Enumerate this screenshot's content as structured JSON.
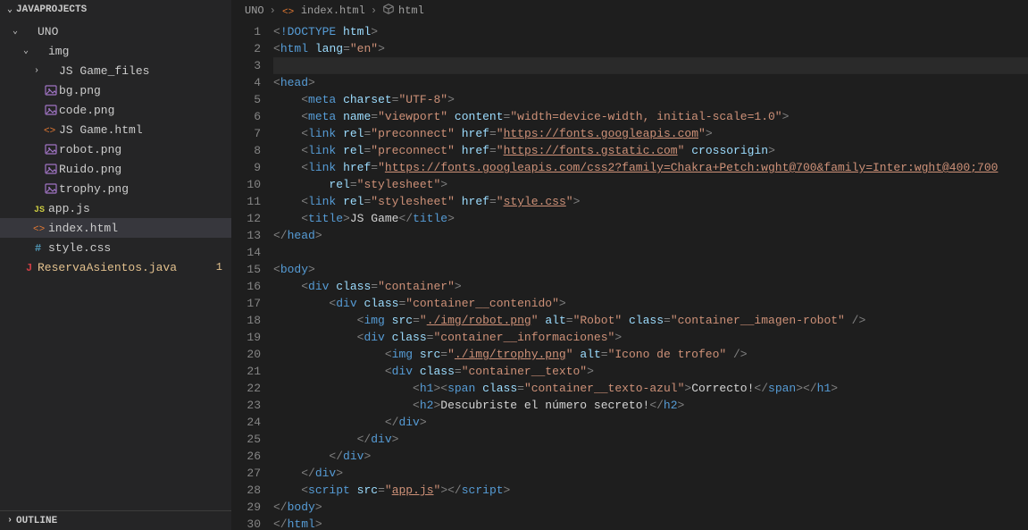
{
  "sidebar": {
    "projectHeader": "JAVAPROJECTS",
    "outline": "OUTLINE",
    "tree": [
      {
        "id": "uno",
        "depth": 0,
        "expand": "open",
        "icon": "",
        "label": "UNO",
        "labelMod": false
      },
      {
        "id": "img",
        "depth": 1,
        "expand": "open",
        "icon": "",
        "label": "img",
        "labelMod": false
      },
      {
        "id": "jsgamefiles",
        "depth": 2,
        "expand": "closed",
        "icon": "",
        "label": "JS Game_files",
        "labelMod": false
      },
      {
        "id": "bg",
        "depth": 2,
        "expand": "none",
        "icon": "image",
        "label": "bg.png",
        "labelMod": false
      },
      {
        "id": "code",
        "depth": 2,
        "expand": "none",
        "icon": "image",
        "label": "code.png",
        "labelMod": false
      },
      {
        "id": "jsgamehtml",
        "depth": 2,
        "expand": "none",
        "icon": "html",
        "label": "JS Game.html",
        "labelMod": false
      },
      {
        "id": "robot",
        "depth": 2,
        "expand": "none",
        "icon": "image",
        "label": "robot.png",
        "labelMod": false
      },
      {
        "id": "ruido",
        "depth": 2,
        "expand": "none",
        "icon": "image",
        "label": "Ruido.png",
        "labelMod": false
      },
      {
        "id": "trophy",
        "depth": 2,
        "expand": "none",
        "icon": "image",
        "label": "trophy.png",
        "labelMod": false
      },
      {
        "id": "appjs",
        "depth": 1,
        "expand": "none",
        "icon": "js",
        "label": "app.js",
        "labelMod": false
      },
      {
        "id": "indexhtml",
        "depth": 1,
        "expand": "none",
        "icon": "html",
        "label": "index.html",
        "labelMod": false,
        "active": true
      },
      {
        "id": "stylecss",
        "depth": 1,
        "expand": "none",
        "icon": "css",
        "label": "style.css",
        "labelMod": false
      },
      {
        "id": "reserva",
        "depth": 0,
        "expand": "none",
        "icon": "java",
        "label": "ReservaAsientos.java",
        "labelMod": true,
        "badge": "1"
      }
    ]
  },
  "breadcrumb": {
    "parts": [
      "UNO",
      "index.html",
      "html"
    ],
    "icon1": "html",
    "icon2": "cube"
  },
  "editor": {
    "lineCount": 30,
    "currentLine": 3,
    "lines": [
      [
        [
          "pun",
          "<"
        ],
        [
          "doctype",
          "!DOCTYPE"
        ],
        [
          "text",
          " "
        ],
        [
          "attr",
          "html"
        ],
        [
          "pun",
          ">"
        ]
      ],
      [
        [
          "pun",
          "<"
        ],
        [
          "tag",
          "html"
        ],
        [
          "text",
          " "
        ],
        [
          "attr",
          "lang"
        ],
        [
          "pun",
          "="
        ],
        [
          "str",
          "\"en\""
        ],
        [
          "pun",
          ">"
        ]
      ],
      [],
      [
        [
          "pun",
          "<"
        ],
        [
          "tag",
          "head"
        ],
        [
          "pun",
          ">"
        ]
      ],
      [
        [
          "text",
          "    "
        ],
        [
          "pun",
          "<"
        ],
        [
          "tag",
          "meta"
        ],
        [
          "text",
          " "
        ],
        [
          "attr",
          "charset"
        ],
        [
          "pun",
          "="
        ],
        [
          "str",
          "\"UTF-8\""
        ],
        [
          "pun",
          ">"
        ]
      ],
      [
        [
          "text",
          "    "
        ],
        [
          "pun",
          "<"
        ],
        [
          "tag",
          "meta"
        ],
        [
          "text",
          " "
        ],
        [
          "attr",
          "name"
        ],
        [
          "pun",
          "="
        ],
        [
          "str",
          "\"viewport\""
        ],
        [
          "text",
          " "
        ],
        [
          "attr",
          "content"
        ],
        [
          "pun",
          "="
        ],
        [
          "str",
          "\"width=device-width, initial-scale=1.0\""
        ],
        [
          "pun",
          ">"
        ]
      ],
      [
        [
          "text",
          "    "
        ],
        [
          "pun",
          "<"
        ],
        [
          "tag",
          "link"
        ],
        [
          "text",
          " "
        ],
        [
          "attr",
          "rel"
        ],
        [
          "pun",
          "="
        ],
        [
          "str",
          "\"preconnect\""
        ],
        [
          "text",
          " "
        ],
        [
          "attr",
          "href"
        ],
        [
          "pun",
          "="
        ],
        [
          "str",
          "\""
        ],
        [
          "link",
          "https://fonts.googleapis.com"
        ],
        [
          "str",
          "\""
        ],
        [
          "pun",
          ">"
        ]
      ],
      [
        [
          "text",
          "    "
        ],
        [
          "pun",
          "<"
        ],
        [
          "tag",
          "link"
        ],
        [
          "text",
          " "
        ],
        [
          "attr",
          "rel"
        ],
        [
          "pun",
          "="
        ],
        [
          "str",
          "\"preconnect\""
        ],
        [
          "text",
          " "
        ],
        [
          "attr",
          "href"
        ],
        [
          "pun",
          "="
        ],
        [
          "str",
          "\""
        ],
        [
          "link",
          "https://fonts.gstatic.com"
        ],
        [
          "str",
          "\""
        ],
        [
          "text",
          " "
        ],
        [
          "attr",
          "crossorigin"
        ],
        [
          "pun",
          ">"
        ]
      ],
      [
        [
          "text",
          "    "
        ],
        [
          "pun",
          "<"
        ],
        [
          "tag",
          "link"
        ],
        [
          "text",
          " "
        ],
        [
          "attr",
          "href"
        ],
        [
          "pun",
          "="
        ],
        [
          "str",
          "\""
        ],
        [
          "link",
          "https://fonts.googleapis.com/css2?family=Chakra+Petch:wght@700&family=Inter:wght@400;700"
        ],
        [
          "str",
          ""
        ]
      ],
      [
        [
          "text",
          "        "
        ],
        [
          "attr",
          "rel"
        ],
        [
          "pun",
          "="
        ],
        [
          "str",
          "\"stylesheet\""
        ],
        [
          "pun",
          ">"
        ]
      ],
      [
        [
          "text",
          "    "
        ],
        [
          "pun",
          "<"
        ],
        [
          "tag",
          "link"
        ],
        [
          "text",
          " "
        ],
        [
          "attr",
          "rel"
        ],
        [
          "pun",
          "="
        ],
        [
          "str",
          "\"stylesheet\""
        ],
        [
          "text",
          " "
        ],
        [
          "attr",
          "href"
        ],
        [
          "pun",
          "="
        ],
        [
          "str",
          "\""
        ],
        [
          "link",
          "style.css"
        ],
        [
          "str",
          "\""
        ],
        [
          "pun",
          ">"
        ]
      ],
      [
        [
          "text",
          "    "
        ],
        [
          "pun",
          "<"
        ],
        [
          "tag",
          "title"
        ],
        [
          "pun",
          ">"
        ],
        [
          "text",
          "JS Game"
        ],
        [
          "pun",
          "</"
        ],
        [
          "tag",
          "title"
        ],
        [
          "pun",
          ">"
        ]
      ],
      [
        [
          "pun",
          "</"
        ],
        [
          "tag",
          "head"
        ],
        [
          "pun",
          ">"
        ]
      ],
      [],
      [
        [
          "pun",
          "<"
        ],
        [
          "tag",
          "body"
        ],
        [
          "pun",
          ">"
        ]
      ],
      [
        [
          "text",
          "    "
        ],
        [
          "pun",
          "<"
        ],
        [
          "tag",
          "div"
        ],
        [
          "text",
          " "
        ],
        [
          "attr",
          "class"
        ],
        [
          "pun",
          "="
        ],
        [
          "str",
          "\"container\""
        ],
        [
          "pun",
          ">"
        ]
      ],
      [
        [
          "text",
          "        "
        ],
        [
          "pun",
          "<"
        ],
        [
          "tag",
          "div"
        ],
        [
          "text",
          " "
        ],
        [
          "attr",
          "class"
        ],
        [
          "pun",
          "="
        ],
        [
          "str",
          "\"container__contenido\""
        ],
        [
          "pun",
          ">"
        ]
      ],
      [
        [
          "text",
          "            "
        ],
        [
          "pun",
          "<"
        ],
        [
          "tag",
          "img"
        ],
        [
          "text",
          " "
        ],
        [
          "attr",
          "src"
        ],
        [
          "pun",
          "="
        ],
        [
          "str",
          "\""
        ],
        [
          "link",
          "./img/robot.png"
        ],
        [
          "str",
          "\""
        ],
        [
          "text",
          " "
        ],
        [
          "attr",
          "alt"
        ],
        [
          "pun",
          "="
        ],
        [
          "str",
          "\"Robot\""
        ],
        [
          "text",
          " "
        ],
        [
          "attr",
          "class"
        ],
        [
          "pun",
          "="
        ],
        [
          "str",
          "\"container__imagen-robot\""
        ],
        [
          "text",
          " "
        ],
        [
          "pun",
          "/>"
        ]
      ],
      [
        [
          "text",
          "            "
        ],
        [
          "pun",
          "<"
        ],
        [
          "tag",
          "div"
        ],
        [
          "text",
          " "
        ],
        [
          "attr",
          "class"
        ],
        [
          "pun",
          "="
        ],
        [
          "str",
          "\"container__informaciones\""
        ],
        [
          "pun",
          ">"
        ]
      ],
      [
        [
          "text",
          "                "
        ],
        [
          "pun",
          "<"
        ],
        [
          "tag",
          "img"
        ],
        [
          "text",
          " "
        ],
        [
          "attr",
          "src"
        ],
        [
          "pun",
          "="
        ],
        [
          "str",
          "\""
        ],
        [
          "link",
          "./img/trophy.png"
        ],
        [
          "str",
          "\""
        ],
        [
          "text",
          " "
        ],
        [
          "attr",
          "alt"
        ],
        [
          "pun",
          "="
        ],
        [
          "str",
          "\"Icono de trofeo\""
        ],
        [
          "text",
          " "
        ],
        [
          "pun",
          "/>"
        ]
      ],
      [
        [
          "text",
          "                "
        ],
        [
          "pun",
          "<"
        ],
        [
          "tag",
          "div"
        ],
        [
          "text",
          " "
        ],
        [
          "attr",
          "class"
        ],
        [
          "pun",
          "="
        ],
        [
          "str",
          "\"container__texto\""
        ],
        [
          "pun",
          ">"
        ]
      ],
      [
        [
          "text",
          "                    "
        ],
        [
          "pun",
          "<"
        ],
        [
          "tag",
          "h1"
        ],
        [
          "pun",
          ">"
        ],
        [
          "pun",
          "<"
        ],
        [
          "tag",
          "span"
        ],
        [
          "text",
          " "
        ],
        [
          "attr",
          "class"
        ],
        [
          "pun",
          "="
        ],
        [
          "str",
          "\"container__texto-azul\""
        ],
        [
          "pun",
          ">"
        ],
        [
          "text",
          "Correcto!"
        ],
        [
          "pun",
          "</"
        ],
        [
          "tag",
          "span"
        ],
        [
          "pun",
          ">"
        ],
        [
          "pun",
          "</"
        ],
        [
          "tag",
          "h1"
        ],
        [
          "pun",
          ">"
        ]
      ],
      [
        [
          "text",
          "                    "
        ],
        [
          "pun",
          "<"
        ],
        [
          "tag",
          "h2"
        ],
        [
          "pun",
          ">"
        ],
        [
          "text",
          "Descubriste el número secreto!"
        ],
        [
          "pun",
          "</"
        ],
        [
          "tag",
          "h2"
        ],
        [
          "pun",
          ">"
        ]
      ],
      [
        [
          "text",
          "                "
        ],
        [
          "pun",
          "</"
        ],
        [
          "tag",
          "div"
        ],
        [
          "pun",
          ">"
        ]
      ],
      [
        [
          "text",
          "            "
        ],
        [
          "pun",
          "</"
        ],
        [
          "tag",
          "div"
        ],
        [
          "pun",
          ">"
        ]
      ],
      [
        [
          "text",
          "        "
        ],
        [
          "pun",
          "</"
        ],
        [
          "tag",
          "div"
        ],
        [
          "pun",
          ">"
        ]
      ],
      [
        [
          "text",
          "    "
        ],
        [
          "pun",
          "</"
        ],
        [
          "tag",
          "div"
        ],
        [
          "pun",
          ">"
        ]
      ],
      [
        [
          "text",
          "    "
        ],
        [
          "pun",
          "<"
        ],
        [
          "tag",
          "script"
        ],
        [
          "text",
          " "
        ],
        [
          "attr",
          "src"
        ],
        [
          "pun",
          "="
        ],
        [
          "str",
          "\""
        ],
        [
          "link",
          "app.js"
        ],
        [
          "str",
          "\""
        ],
        [
          "pun",
          ">"
        ],
        [
          "pun",
          "</"
        ],
        [
          "tag",
          "script"
        ],
        [
          "pun",
          ">"
        ]
      ],
      [
        [
          "pun",
          "</"
        ],
        [
          "tag",
          "body"
        ],
        [
          "pun",
          ">"
        ]
      ],
      [
        [
          "pun",
          "</"
        ],
        [
          "tag",
          "html"
        ],
        [
          "pun",
          ">"
        ]
      ]
    ]
  }
}
